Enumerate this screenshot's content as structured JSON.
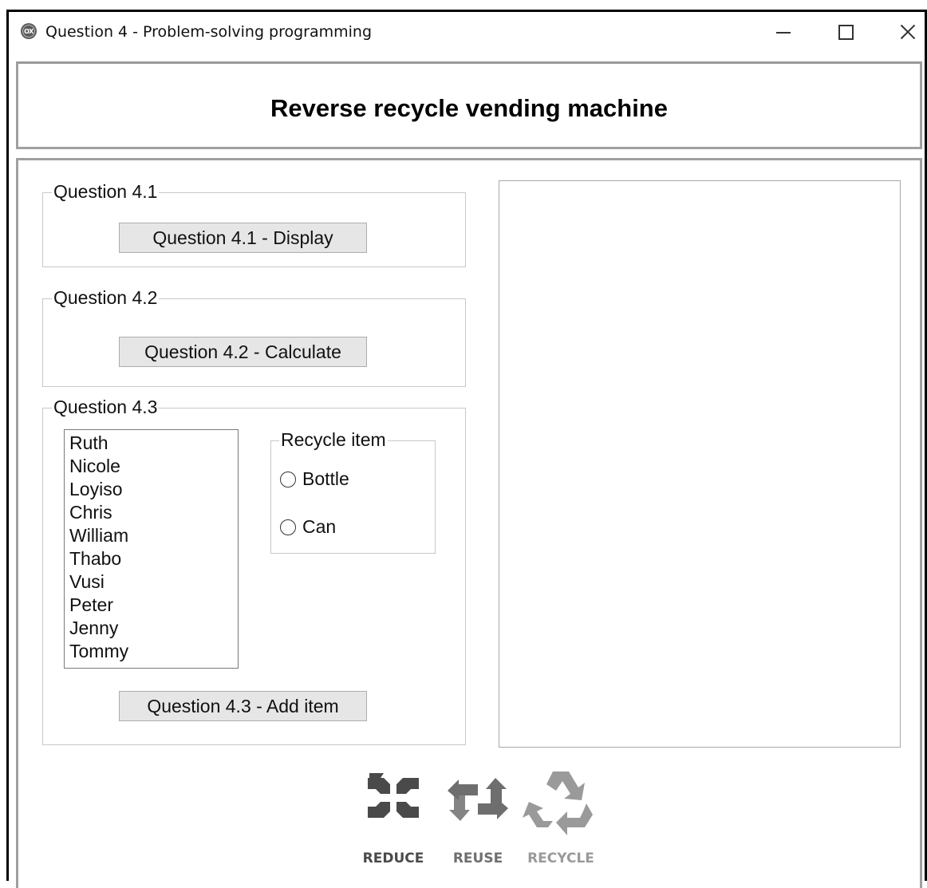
{
  "window": {
    "title": "Question 4 - Problem-solving programming",
    "app_icon_text": "OX",
    "controls": {
      "minimize": "minimize-icon",
      "maximize": "maximize-icon",
      "close": "close-icon"
    }
  },
  "header": {
    "title": "Reverse recycle vending machine"
  },
  "q41": {
    "legend": "Question 4.1",
    "button": "Question 4.1 - Display"
  },
  "q42": {
    "legend": "Question 4.2",
    "button": "Question 4.2 - Calculate"
  },
  "q43": {
    "legend": "Question 4.3",
    "names": [
      "Ruth",
      "Nicole",
      "Loyiso",
      "Chris",
      "William",
      "Thabo",
      "Vusi",
      "Peter",
      "Jenny",
      "Tommy"
    ],
    "recycle_group": {
      "legend": "Recycle item",
      "options": [
        "Bottle",
        "Can"
      ]
    },
    "button": "Question 4.3 - Add item"
  },
  "output": {
    "text": ""
  },
  "logo": {
    "labels": [
      "REDUCE",
      "REUSE",
      "RECYCLE"
    ],
    "colors": {
      "reduce": "#4a4a4a",
      "reuse": "#6e6e6e",
      "recycle": "#9a9a9a"
    }
  }
}
